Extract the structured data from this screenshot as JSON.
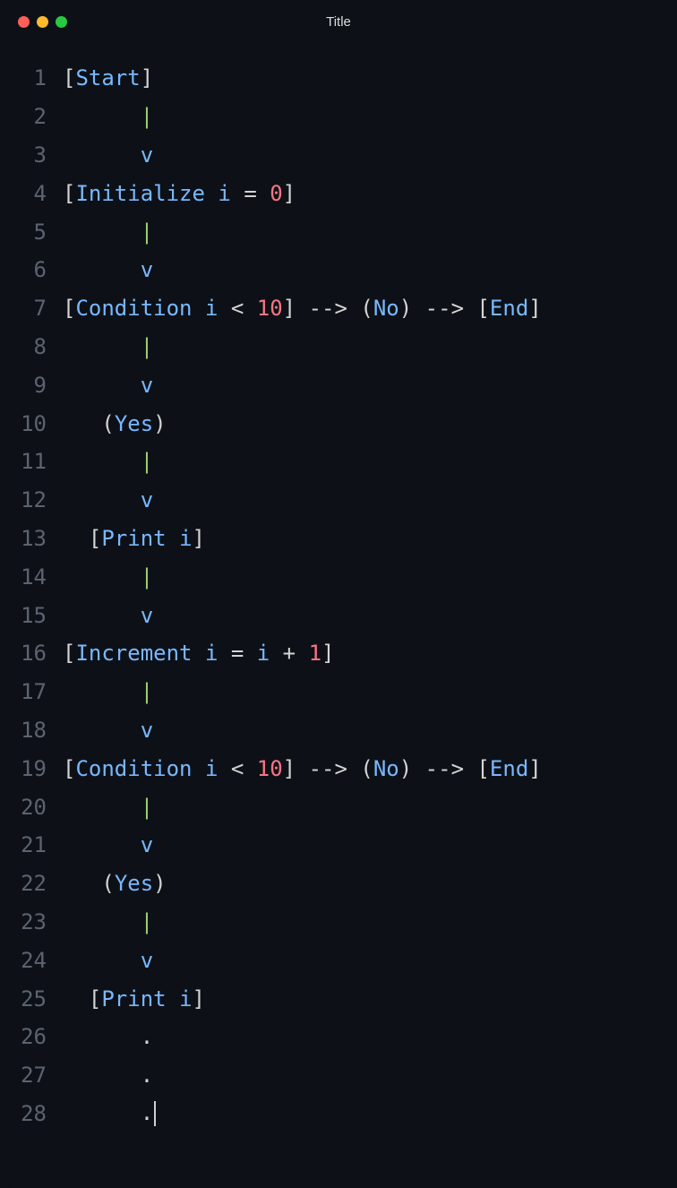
{
  "window": {
    "title": "Title"
  },
  "editor": {
    "lines": [
      {
        "num": "1",
        "tokens": [
          {
            "t": "[",
            "c": "bracket"
          },
          {
            "t": "Start",
            "c": "keyword"
          },
          {
            "t": "]",
            "c": "bracket"
          }
        ]
      },
      {
        "num": "2",
        "tokens": [
          {
            "t": "      ",
            "c": "plain"
          },
          {
            "t": "|",
            "c": "pipe"
          }
        ]
      },
      {
        "num": "3",
        "tokens": [
          {
            "t": "      ",
            "c": "plain"
          },
          {
            "t": "v",
            "c": "arrow-v"
          }
        ]
      },
      {
        "num": "4",
        "tokens": [
          {
            "t": "[",
            "c": "bracket"
          },
          {
            "t": "Initialize",
            "c": "keyword"
          },
          {
            "t": " ",
            "c": "plain"
          },
          {
            "t": "i",
            "c": "ident"
          },
          {
            "t": " ",
            "c": "plain"
          },
          {
            "t": "=",
            "c": "operator"
          },
          {
            "t": " ",
            "c": "plain"
          },
          {
            "t": "0",
            "c": "number"
          },
          {
            "t": "]",
            "c": "bracket"
          }
        ]
      },
      {
        "num": "5",
        "tokens": [
          {
            "t": "      ",
            "c": "plain"
          },
          {
            "t": "|",
            "c": "pipe"
          }
        ]
      },
      {
        "num": "6",
        "tokens": [
          {
            "t": "      ",
            "c": "plain"
          },
          {
            "t": "v",
            "c": "arrow-v"
          }
        ]
      },
      {
        "num": "7",
        "tokens": [
          {
            "t": "[",
            "c": "bracket"
          },
          {
            "t": "Condition",
            "c": "keyword"
          },
          {
            "t": " ",
            "c": "plain"
          },
          {
            "t": "i",
            "c": "ident"
          },
          {
            "t": " ",
            "c": "plain"
          },
          {
            "t": "<",
            "c": "operator"
          },
          {
            "t": " ",
            "c": "plain"
          },
          {
            "t": "10",
            "c": "number"
          },
          {
            "t": "]",
            "c": "bracket"
          },
          {
            "t": " ",
            "c": "plain"
          },
          {
            "t": "--",
            "c": "dash"
          },
          {
            "t": ">",
            "c": "gt"
          },
          {
            "t": " ",
            "c": "plain"
          },
          {
            "t": "(",
            "c": "paren"
          },
          {
            "t": "No",
            "c": "keyword"
          },
          {
            "t": ")",
            "c": "paren"
          },
          {
            "t": " ",
            "c": "plain"
          },
          {
            "t": "--",
            "c": "dash"
          },
          {
            "t": ">",
            "c": "gt"
          },
          {
            "t": " ",
            "c": "plain"
          },
          {
            "t": "[",
            "c": "bracket"
          },
          {
            "t": "End",
            "c": "keyword"
          },
          {
            "t": "]",
            "c": "bracket"
          }
        ]
      },
      {
        "num": "8",
        "tokens": [
          {
            "t": "      ",
            "c": "plain"
          },
          {
            "t": "|",
            "c": "pipe"
          }
        ]
      },
      {
        "num": "9",
        "tokens": [
          {
            "t": "      ",
            "c": "plain"
          },
          {
            "t": "v",
            "c": "arrow-v"
          }
        ]
      },
      {
        "num": "10",
        "tokens": [
          {
            "t": "   ",
            "c": "plain"
          },
          {
            "t": "(",
            "c": "paren"
          },
          {
            "t": "Yes",
            "c": "keyword"
          },
          {
            "t": ")",
            "c": "paren"
          }
        ]
      },
      {
        "num": "11",
        "tokens": [
          {
            "t": "      ",
            "c": "plain"
          },
          {
            "t": "|",
            "c": "pipe"
          }
        ]
      },
      {
        "num": "12",
        "tokens": [
          {
            "t": "      ",
            "c": "plain"
          },
          {
            "t": "v",
            "c": "arrow-v"
          }
        ]
      },
      {
        "num": "13",
        "tokens": [
          {
            "t": "  ",
            "c": "plain"
          },
          {
            "t": "[",
            "c": "bracket"
          },
          {
            "t": "Print",
            "c": "keyword"
          },
          {
            "t": " ",
            "c": "plain"
          },
          {
            "t": "i",
            "c": "ident"
          },
          {
            "t": "]",
            "c": "bracket"
          }
        ]
      },
      {
        "num": "14",
        "tokens": [
          {
            "t": "      ",
            "c": "plain"
          },
          {
            "t": "|",
            "c": "pipe"
          }
        ]
      },
      {
        "num": "15",
        "tokens": [
          {
            "t": "      ",
            "c": "plain"
          },
          {
            "t": "v",
            "c": "arrow-v"
          }
        ]
      },
      {
        "num": "16",
        "tokens": [
          {
            "t": "[",
            "c": "bracket"
          },
          {
            "t": "Increment",
            "c": "keyword"
          },
          {
            "t": " ",
            "c": "plain"
          },
          {
            "t": "i",
            "c": "ident"
          },
          {
            "t": " ",
            "c": "plain"
          },
          {
            "t": "=",
            "c": "operator"
          },
          {
            "t": " ",
            "c": "plain"
          },
          {
            "t": "i",
            "c": "ident"
          },
          {
            "t": " ",
            "c": "plain"
          },
          {
            "t": "+",
            "c": "operator"
          },
          {
            "t": " ",
            "c": "plain"
          },
          {
            "t": "1",
            "c": "number"
          },
          {
            "t": "]",
            "c": "bracket"
          }
        ]
      },
      {
        "num": "17",
        "tokens": [
          {
            "t": "      ",
            "c": "plain"
          },
          {
            "t": "|",
            "c": "pipe"
          }
        ]
      },
      {
        "num": "18",
        "tokens": [
          {
            "t": "      ",
            "c": "plain"
          },
          {
            "t": "v",
            "c": "arrow-v"
          }
        ]
      },
      {
        "num": "19",
        "tokens": [
          {
            "t": "[",
            "c": "bracket"
          },
          {
            "t": "Condition",
            "c": "keyword"
          },
          {
            "t": " ",
            "c": "plain"
          },
          {
            "t": "i",
            "c": "ident"
          },
          {
            "t": " ",
            "c": "plain"
          },
          {
            "t": "<",
            "c": "operator"
          },
          {
            "t": " ",
            "c": "plain"
          },
          {
            "t": "10",
            "c": "number"
          },
          {
            "t": "]",
            "c": "bracket"
          },
          {
            "t": " ",
            "c": "plain"
          },
          {
            "t": "--",
            "c": "dash"
          },
          {
            "t": ">",
            "c": "gt"
          },
          {
            "t": " ",
            "c": "plain"
          },
          {
            "t": "(",
            "c": "paren"
          },
          {
            "t": "No",
            "c": "keyword"
          },
          {
            "t": ")",
            "c": "paren"
          },
          {
            "t": " ",
            "c": "plain"
          },
          {
            "t": "--",
            "c": "dash"
          },
          {
            "t": ">",
            "c": "gt"
          },
          {
            "t": " ",
            "c": "plain"
          },
          {
            "t": "[",
            "c": "bracket"
          },
          {
            "t": "End",
            "c": "keyword"
          },
          {
            "t": "]",
            "c": "bracket"
          }
        ]
      },
      {
        "num": "20",
        "tokens": [
          {
            "t": "      ",
            "c": "plain"
          },
          {
            "t": "|",
            "c": "pipe"
          }
        ]
      },
      {
        "num": "21",
        "tokens": [
          {
            "t": "      ",
            "c": "plain"
          },
          {
            "t": "v",
            "c": "arrow-v"
          }
        ]
      },
      {
        "num": "22",
        "tokens": [
          {
            "t": "   ",
            "c": "plain"
          },
          {
            "t": "(",
            "c": "paren"
          },
          {
            "t": "Yes",
            "c": "keyword"
          },
          {
            "t": ")",
            "c": "paren"
          }
        ]
      },
      {
        "num": "23",
        "tokens": [
          {
            "t": "      ",
            "c": "plain"
          },
          {
            "t": "|",
            "c": "pipe"
          }
        ]
      },
      {
        "num": "24",
        "tokens": [
          {
            "t": "      ",
            "c": "plain"
          },
          {
            "t": "v",
            "c": "arrow-v"
          }
        ]
      },
      {
        "num": "25",
        "tokens": [
          {
            "t": "  ",
            "c": "plain"
          },
          {
            "t": "[",
            "c": "bracket"
          },
          {
            "t": "Print",
            "c": "keyword"
          },
          {
            "t": " ",
            "c": "plain"
          },
          {
            "t": "i",
            "c": "ident"
          },
          {
            "t": "]",
            "c": "bracket"
          }
        ]
      },
      {
        "num": "26",
        "tokens": [
          {
            "t": "      ",
            "c": "plain"
          },
          {
            "t": ".",
            "c": "dot"
          }
        ]
      },
      {
        "num": "27",
        "tokens": [
          {
            "t": "      ",
            "c": "plain"
          },
          {
            "t": ".",
            "c": "dot"
          }
        ]
      },
      {
        "num": "28",
        "tokens": [
          {
            "t": "      ",
            "c": "plain"
          },
          {
            "t": ".",
            "c": "dot"
          }
        ],
        "cursor": true
      }
    ]
  }
}
